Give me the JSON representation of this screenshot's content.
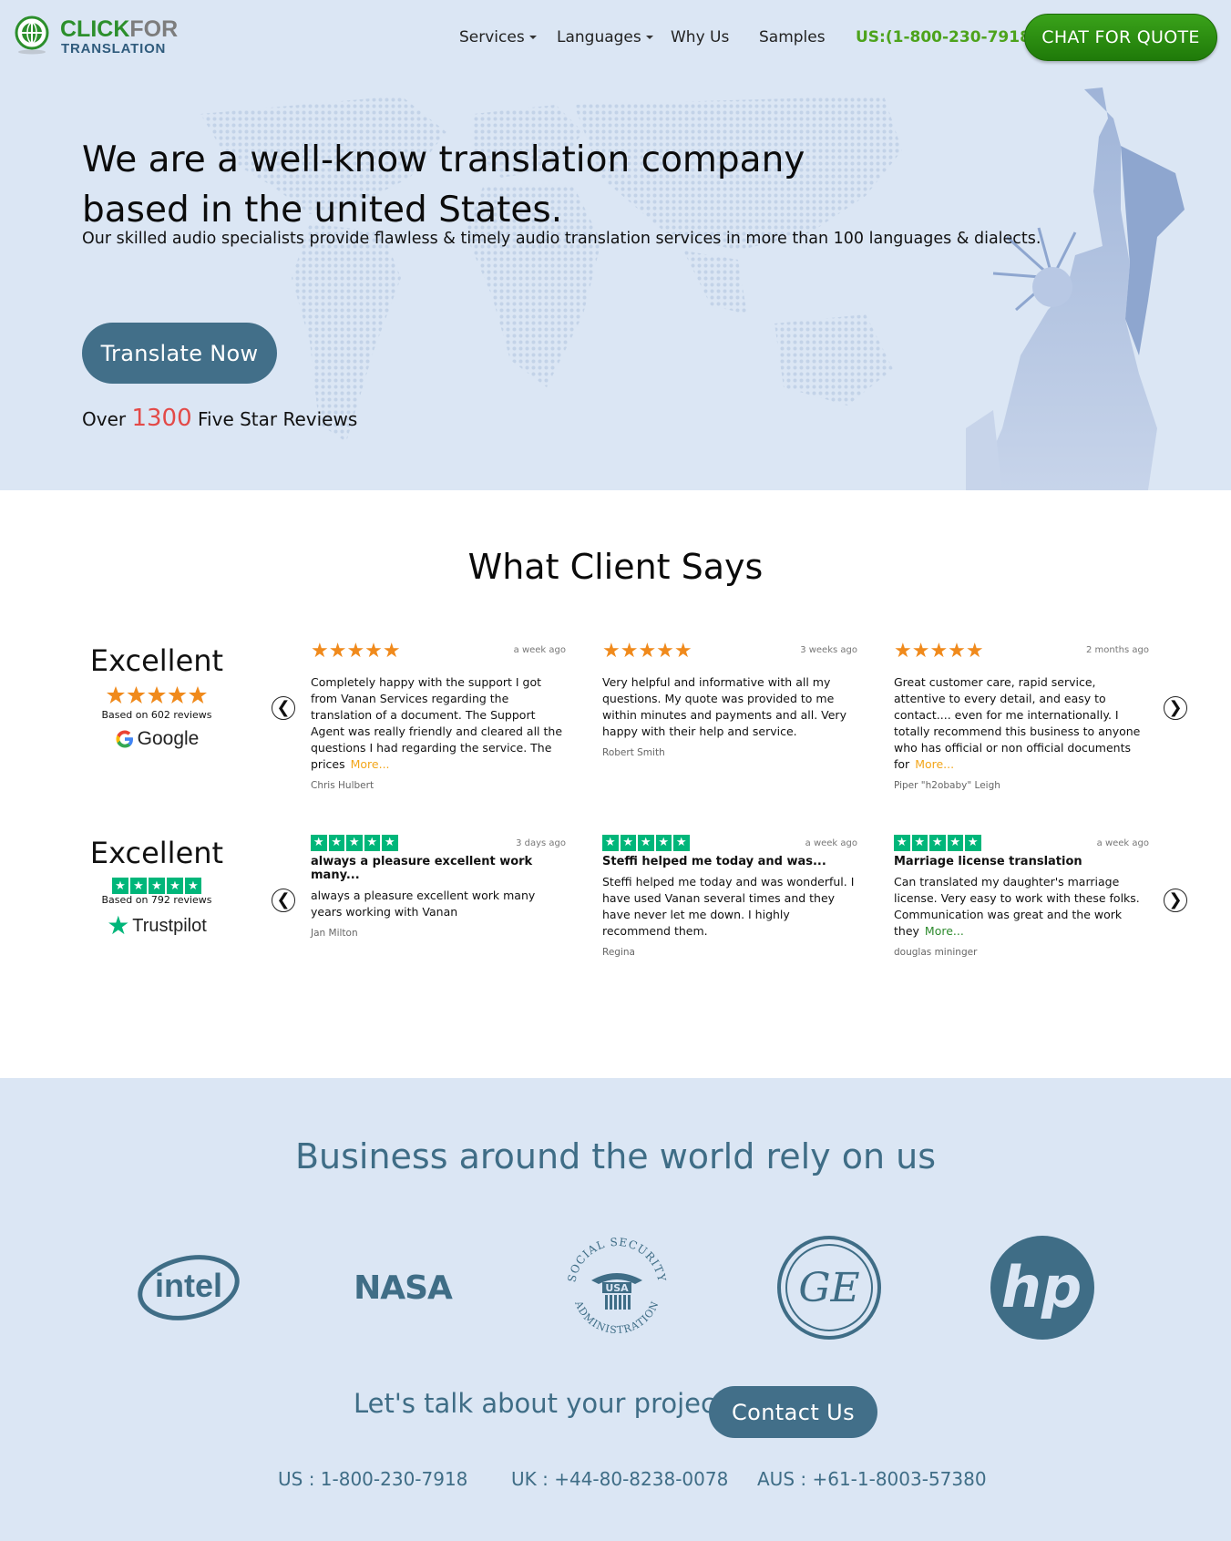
{
  "header": {
    "brand_line1_a": "CLICK",
    "brand_line1_b": "FOR",
    "brand_line2": "TRANSLATION",
    "nav": [
      {
        "label": "Services",
        "dropdown": true
      },
      {
        "label": "Languages",
        "dropdown": true
      },
      {
        "label": "Why Us",
        "dropdown": false
      },
      {
        "label": "Samples",
        "dropdown": false
      }
    ],
    "phone": "US:(1-800-230-7918)",
    "cta": "CHAT FOR QUOTE"
  },
  "hero": {
    "title": "We are a well-know translation company based in the united States.",
    "subtitle": "Our skilled audio specialists provide flawless & timely audio translation services in more than 100 languages & dialects.",
    "button": "Translate Now",
    "reviews_prefix": "Over",
    "reviews_count": "1300",
    "reviews_suffix": "Five Star Reviews"
  },
  "testimonials": {
    "title": "What Client Says",
    "google": {
      "label": "Excellent",
      "stars": 5,
      "based_on": "Based on 602 reviews",
      "provider": "Google",
      "reviews": [
        {
          "time": "a week ago",
          "stars": 5,
          "text": "Completely happy with the support I got from Vanan Services regarding the translation of a document. The Support Agent was really friendly and cleared all the questions I had regarding the service. The prices",
          "more": "More...",
          "author": "Chris Hulbert"
        },
        {
          "time": "3 weeks ago",
          "stars": 5,
          "text": "Very helpful and informative with all my questions. My quote was provided to me within minutes and payments and all. Very happy with their help and service.",
          "more": "",
          "author": "Robert Smith"
        },
        {
          "time": "2 months ago",
          "stars": 5,
          "text": "Great customer care, rapid service, attentive to every detail, and easy to contact.... even for me internationally. I totally recommend this business to anyone who has official or non official documents for",
          "more": "More...",
          "author": "Piper \"h2obaby\" Leigh"
        }
      ]
    },
    "trustpilot": {
      "label": "Excellent",
      "stars": 5,
      "based_on": "Based on 792 reviews",
      "provider": "Trustpilot",
      "reviews": [
        {
          "time": "3 days ago",
          "stars": 5,
          "title": "always a pleasure excellent work many...",
          "text": "always a pleasure excellent work many years working with Vanan",
          "more": "",
          "author": "Jan Milton"
        },
        {
          "time": "a week ago",
          "stars": 5,
          "title": "Steffi helped me today and was...",
          "text": "Steffi helped me today and was wonderful. I have used Vanan several times and they have never let me down. I highly recommend them.",
          "more": "",
          "author": "Regina"
        },
        {
          "time": "a week ago",
          "stars": 5,
          "title": "Marriage license translation",
          "text": "Can translated my daughter's marriage license. Very easy to work with these folks. Communication was great and the work they",
          "more": "More...",
          "author": "douglas mininger"
        }
      ]
    },
    "prev": "❮",
    "next": "❯"
  },
  "clients": {
    "title": "Business around the world rely on us",
    "logos": [
      {
        "name": "intel",
        "text": "intel"
      },
      {
        "name": "nasa",
        "text": "NASA"
      },
      {
        "name": "ssa",
        "text_top": "SOCIAL SECURITY",
        "text_mid": "USA",
        "text_bottom": "ADMINISTRATION"
      },
      {
        "name": "ge",
        "text": "GE"
      },
      {
        "name": "hp",
        "text": "hp"
      }
    ],
    "talk": "Let's talk about your project",
    "contact": "Contact Us",
    "phones": [
      "US : 1-800-230-7918",
      "UK : +44-80-8238-0078",
      "AUS : +61-1-8003-57380"
    ]
  },
  "colors": {
    "hero_bg": "#dbe6f4",
    "accent": "#426f89",
    "green": "#2c8f2c",
    "star_orange": "#f08a1c",
    "trustpilot_green": "#00b67a",
    "review_count_red": "#e34a48"
  }
}
